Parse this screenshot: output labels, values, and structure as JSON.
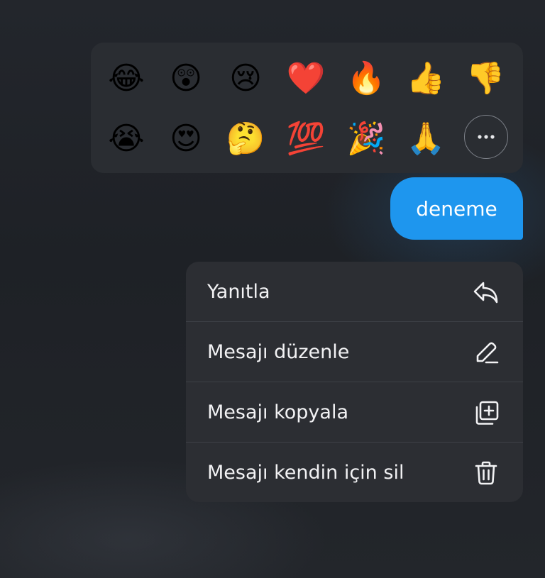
{
  "reactions": {
    "row1": [
      "😂",
      "😲",
      "😢",
      "❤️",
      "🔥",
      "👍",
      "👎"
    ],
    "row2": [
      "😭",
      "😍",
      "🤔",
      "💯",
      "🎉",
      "🙏"
    ],
    "more_icon": "more-horizontal-icon"
  },
  "message": {
    "text": "deneme",
    "bubble_color": "#1e96ee"
  },
  "menu": {
    "items": [
      {
        "label": "Yanıtla",
        "icon": "reply-icon"
      },
      {
        "label": "Mesajı düzenle",
        "icon": "edit-icon"
      },
      {
        "label": "Mesajı kopyala",
        "icon": "copy-icon"
      },
      {
        "label": "Mesajı kendin için sil",
        "icon": "trash-icon"
      }
    ]
  }
}
